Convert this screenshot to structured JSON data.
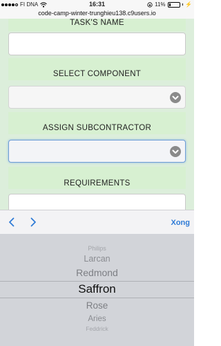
{
  "status_bar": {
    "carrier": "FI DNA",
    "time": "16:31",
    "battery_percent": "11%",
    "battery_level": 0.11
  },
  "url_bar": {
    "url": "code-camp-winter-trunghieu138.c9users.io"
  },
  "form": {
    "task_name_label": "TASK'S NAME",
    "select_component_label": "SELECT COMPONENT",
    "assign_subcontractor_label": "ASSIGN SUBCONTRACTOR",
    "requirements_label": "REQUIREMENTS"
  },
  "toolbar": {
    "done_label": "Xong"
  },
  "picker": {
    "items": [
      "Philips",
      "Larcan",
      "Redmond",
      "Saffron",
      "Rose",
      "Aries",
      "Feddrick"
    ],
    "selected": "Saffron"
  },
  "colors": {
    "accent": "#2f7bd6",
    "label_bg": "#d7f0d1",
    "picker_bg": "#d2d4d9"
  }
}
